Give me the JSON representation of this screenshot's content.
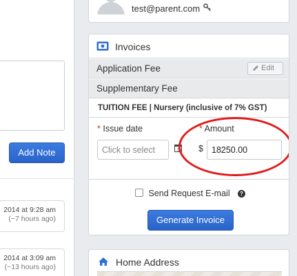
{
  "left": {
    "add_note_label": "Add Note",
    "notes": [
      {
        "timestamp": "2014 at 9:28 am",
        "ago": "(~7 hours ago)"
      },
      {
        "timestamp": "2014 at 3:09 am",
        "ago": "(~13 hours ago)"
      }
    ]
  },
  "user": {
    "email": "test@parent.com",
    "key_icon": "key-icon"
  },
  "invoices": {
    "title": "Invoices",
    "icon": "money-icon",
    "fees": [
      {
        "label": "Application Fee",
        "edit_label": "Edit"
      },
      {
        "label": "Supplementary Fee"
      }
    ],
    "tuition_title": "TUITION FEE | Nursery (inclusive of 7% GST)",
    "issue_date": {
      "label": "Issue date",
      "required_mark": "*",
      "placeholder": "Click to select"
    },
    "amount": {
      "label": "Amount",
      "required_mark": "*",
      "currency": "$",
      "value": "18250.00"
    },
    "send_email_label": "Send Request E-mail",
    "help_mark": "?",
    "generate_label": "Generate Invoice",
    "highlight_color": "#e11b1b",
    "button_color": "#2f6fd6"
  },
  "address": {
    "title": "Home Address",
    "icon": "home-icon"
  }
}
